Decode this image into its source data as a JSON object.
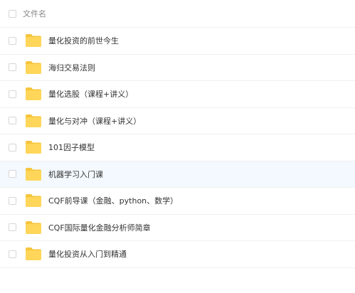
{
  "header": {
    "filename_label": "文件名"
  },
  "folders": [
    {
      "name": "量化投资的前世今生"
    },
    {
      "name": "海归交易法则"
    },
    {
      "name": "量化选股（课程+讲义）"
    },
    {
      "name": "量化与对冲（课程+讲义）"
    },
    {
      "name": "101因子模型"
    },
    {
      "name": "机器学习入门课",
      "hovered": true
    },
    {
      "name": "CQF前导课（金融、python、数学）"
    },
    {
      "name": "CQF国际量化金融分析师简章"
    },
    {
      "name": "量化投资从入门到精通"
    }
  ],
  "colors": {
    "folder_fill": "#ffd659",
    "folder_tab": "#f5c53d",
    "hover_row": "#f3f9fe",
    "divider": "#f0f0f0"
  },
  "icons": {
    "folder": "folder-icon"
  }
}
